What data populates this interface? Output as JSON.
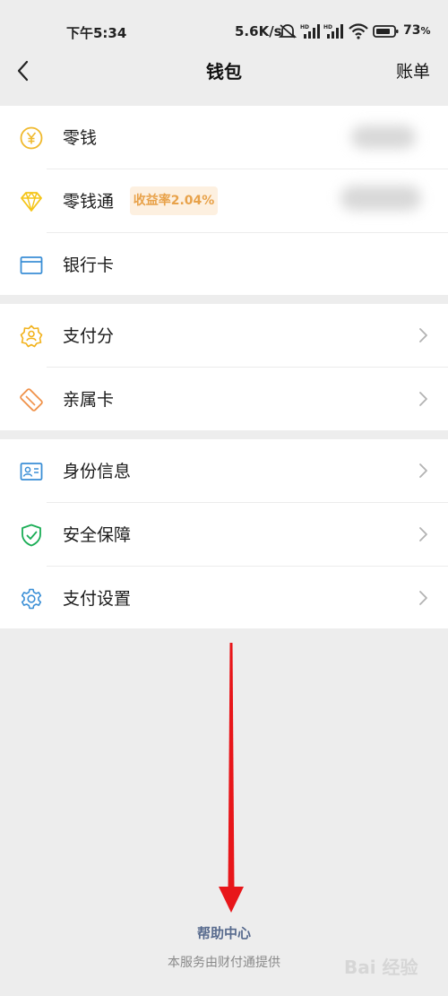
{
  "status_bar": {
    "time": "下午5:34",
    "network_speed": "5.6K/s",
    "battery_percent": "73",
    "battery_suffix": "%"
  },
  "nav": {
    "title": "钱包",
    "right_action": "账单",
    "back_icon": "chevron-left-icon"
  },
  "wallet": {
    "items": [
      {
        "label": "零钱",
        "icon": "yen-coin-icon",
        "color": "#f0b92d"
      },
      {
        "label": "零钱通",
        "icon": "diamond-icon",
        "color": "#f5c518",
        "badge": "收益率2.04%"
      },
      {
        "label": "银行卡",
        "icon": "bank-card-icon",
        "color": "#3b8fd6"
      }
    ]
  },
  "services": {
    "items": [
      {
        "label": "支付分",
        "icon": "pay-score-icon",
        "color": "#f2b21c"
      },
      {
        "label": "亲属卡",
        "icon": "family-card-icon",
        "color": "#f0924a"
      }
    ]
  },
  "settings": {
    "items": [
      {
        "label": "身份信息",
        "icon": "id-card-icon",
        "color": "#3b8fd6"
      },
      {
        "label": "安全保障",
        "icon": "shield-check-icon",
        "color": "#1aad55"
      },
      {
        "label": "支付设置",
        "icon": "gear-icon",
        "color": "#3b8fd6"
      }
    ]
  },
  "footer": {
    "help": "帮助中心",
    "note": "本服务由财付通提供"
  },
  "annotation": {
    "arrow_color": "#e8161a"
  },
  "watermark": {
    "text": "Bai 经验"
  }
}
